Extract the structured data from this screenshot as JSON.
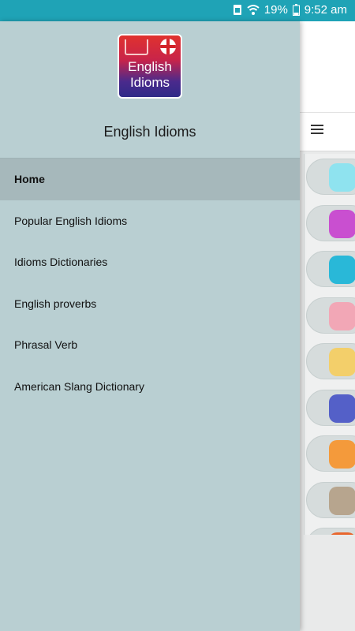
{
  "status_bar": {
    "battery": "19%",
    "time": "9:52 am",
    "icons": [
      "sim-icon",
      "wifi-icon",
      "battery-icon"
    ]
  },
  "drawer": {
    "logo_line1": "English",
    "logo_line2": "Idioms",
    "title": "English Idioms",
    "items": [
      {
        "label": "Home",
        "active": true
      },
      {
        "label": "Popular English Idioms",
        "active": false
      },
      {
        "label": "Idioms Dictionaries",
        "active": false
      },
      {
        "label": "English proverbs",
        "active": false
      },
      {
        "label": "Phrasal Verb",
        "active": false
      },
      {
        "label": "American Slang Dictionary",
        "active": false
      }
    ]
  },
  "background_app": {
    "menu_icon": "hamburger-icon",
    "list_icon_colors": [
      "#8fe3ef",
      "#c94fd0",
      "#29b8d8",
      "#f2a7b6",
      "#f3cf6a",
      "#5460c8",
      "#f49a3b",
      "#b7a58e",
      "#e8672e"
    ]
  }
}
